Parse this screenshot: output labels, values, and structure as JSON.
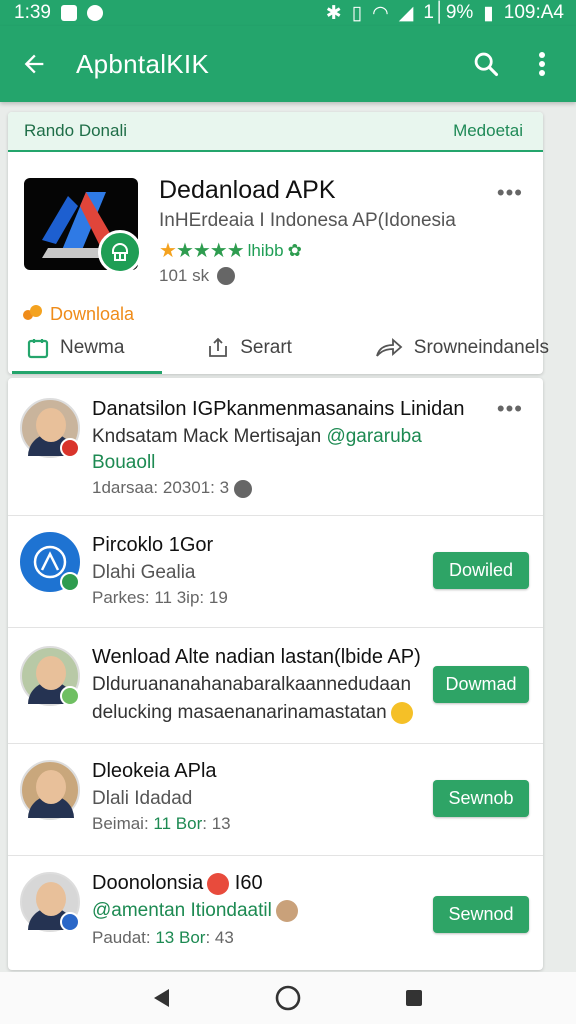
{
  "status": {
    "time": "1:39",
    "battery": "1│9%",
    "clock_right": "109:A4"
  },
  "appbar": {
    "title": "ApbntalKIK"
  },
  "banner": {
    "left": "Rando Donali",
    "right": "Medoetai",
    "app": {
      "name": "Dedanload APK",
      "subtitle": "InHErdeaia I Indonesa AP(Idonesia",
      "rating_text": "lhibb",
      "meta": "101 sk",
      "download_link": "Downloala"
    },
    "tabs": [
      "Newma",
      "Serart",
      "Srowneindanels"
    ]
  },
  "colors": {
    "accent": "#24a56c",
    "button": "#2ea466",
    "orange": "#ef8c1a"
  },
  "list": [
    {
      "title": "Danatsilon IGPkanmenmasanains Linidan",
      "line2": "Kndsatam Mack Mertisajan",
      "line2_green": "@gararuba",
      "line3": "Bouaoll",
      "meta": "1darsaa: 20301: 3",
      "action": "more"
    },
    {
      "title": "Pircoklo 1Gor",
      "line2": "Dlahi Gealia",
      "meta": "Parkes: 11 3ip: 19",
      "button": "Dowiled"
    },
    {
      "title": "Wenload Alte nadian lastan(lbide AP)",
      "line2": "Dlduruananahanabaralkaannedudaan",
      "line3": "delucking masaenanarinamastatan",
      "button": "Dowmad"
    },
    {
      "title": "Dleokeia APla",
      "line2": "Dlali Idadad",
      "meta_a": "Beimai",
      "meta_b": "11 Bor",
      "meta_c": "13",
      "button": "Sewnob"
    },
    {
      "title": "Doonolonsia",
      "title_b": "I60",
      "line2": "@amentan Itiondaatil",
      "meta_a": "Paudat",
      "meta_b": "13 Bor",
      "meta_c": "43",
      "button": "Sewnod"
    }
  ]
}
